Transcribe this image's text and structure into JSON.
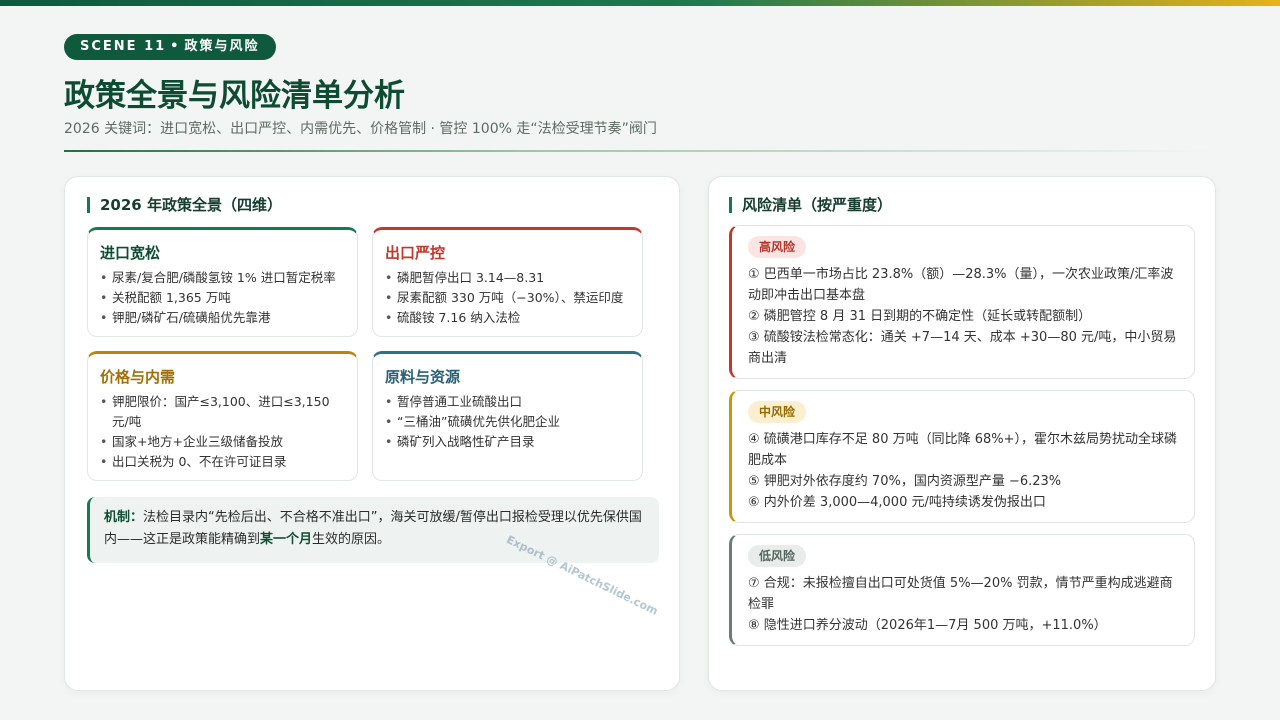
{
  "header": {
    "scene_label": "SCENE 11",
    "scene_sep": "•",
    "scene_topic": "政策与风险",
    "title": "政策全景与风险清单分析",
    "subtitle": "2026 关键词：进口宽松、出口严控、内需优先、价格管制 · 管控 100% 走“法检受理节奏”阀门"
  },
  "left": {
    "heading": "2026 年政策全景（四维）",
    "cards": [
      {
        "title": "进口宽松",
        "items": [
          "尿素/复合肥/磷酸氢铵 1% 进口暂定税率",
          "关税配额 1,365 万吨",
          "钾肥/磷矿石/硫磺船优先靠港"
        ]
      },
      {
        "title": "出口严控",
        "items": [
          "磷肥暂停出口 3.14—8.31",
          "尿素配额 330 万吨（−30%）、禁运印度",
          "硫酸铵 7.16 纳入法检"
        ]
      },
      {
        "title": "价格与内需",
        "items": [
          "钾肥限价：国产≤3,100、进口≤3,150 元/吨",
          "国家+地方+企业三级储备投放",
          "出口关税为 0、不在许可证目录"
        ]
      },
      {
        "title": "原料与资源",
        "items": [
          "暂停普通工业硫酸出口",
          "“三桶油”硫磺优先供化肥企业",
          "磷矿列入战略性矿产目录"
        ]
      }
    ],
    "mechanism": {
      "label": "机制：",
      "text1": "法检目录内“先检后出、不合格不准出口”，海关可放缓/暂停出口报检受理以优先保供国内——这正是政策能精确到",
      "emph": "某一个月",
      "text2": "生效的原因。"
    },
    "watermark": "Export @ AiPatchSlide.com"
  },
  "right": {
    "heading": "风险清单（按严重度）",
    "risks": [
      {
        "level": "高风险",
        "items": [
          "① 巴西单一市场占比 23.8%（额）—28.3%（量），一次农业政策/汇率波动即冲击出口基本盘",
          "② 磷肥管控 8 月 31 日到期的不确定性（延长或转配额制）",
          "③ 硫酸铵法检常态化：通关 +7—14 天、成本 +30—80 元/吨，中小贸易商出清"
        ]
      },
      {
        "level": "中风险",
        "items": [
          "④ 硫磺港口库存不足 80 万吨（同比降 68%+），霍尔木兹局势扰动全球磷肥成本",
          "⑤ 钾肥对外依存度约 70%，国内资源型产量 −6.23%",
          "⑥ 内外价差 3,000—4,000 元/吨持续诱发伪报出口"
        ]
      },
      {
        "level": "低风险",
        "items": [
          "⑦ 合规：未报检擅自出口可处货值 5%—20% 罚款，情节严重构成逃避商检罪",
          "⑧ 隐性进口养分波动（2026年1—7月 500 万吨，+11.0%）"
        ]
      }
    ]
  },
  "colors": {
    "brand": "#0f5a3d",
    "high": "#c0392b",
    "mid": "#c8960c",
    "low": "#6b7d74",
    "raw": "#2f6f87",
    "price": "#b8860b"
  }
}
